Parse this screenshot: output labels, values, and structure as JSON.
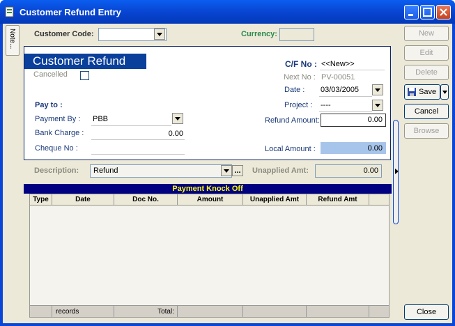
{
  "window": {
    "title": "Customer Refund Entry"
  },
  "sidebar_tab": {
    "label": "Note..."
  },
  "header": {
    "customer_code_label": "Customer Code:",
    "customer_code_value": "",
    "currency_label": "Currency:",
    "currency_value": ""
  },
  "panel": {
    "title": "Customer Refund",
    "cancelled_label": "Cancelled",
    "cf_no_label": "C/F No :",
    "cf_no_value": "<<New>>",
    "next_no_label": "Next No :",
    "next_no_value": "PV-00051",
    "date_label": "Date :",
    "date_value": "03/03/2005",
    "project_label": "Project :",
    "project_value": "----",
    "pay_to_label": "Pay to :",
    "payment_by_label": "Payment By :",
    "payment_by_value": "PBB",
    "bank_charge_label": "Bank Charge :",
    "bank_charge_value": "0.00",
    "cheque_no_label": "Cheque No :",
    "cheque_no_value": "",
    "refund_amount_label": "Refund Amount:",
    "refund_amount_value": "0.00",
    "local_amount_label": "Local Amount :",
    "local_amount_value": "0.00"
  },
  "description": {
    "label": "Description:",
    "value": "Refund",
    "more_label": "...",
    "unapplied_label": "Unapplied Amt:",
    "unapplied_value": "0.00"
  },
  "grid": {
    "title": "Payment Knock Off",
    "columns": [
      "Type",
      "Date",
      "Doc No.",
      "Amount",
      "Unapplied Amt",
      "Refund Amt"
    ],
    "footer_records": "records",
    "footer_total": "Total:"
  },
  "buttons": {
    "new": "New",
    "edit": "Edit",
    "delete": "Delete",
    "save": "Save",
    "cancel": "Cancel",
    "browse": "Browse",
    "close": "Close"
  },
  "colors": {
    "title_bar": "#0a46d8",
    "banner": "#0a3f9b",
    "grid_title_bg": "#000080",
    "grid_title_fg": "#ffff00"
  }
}
